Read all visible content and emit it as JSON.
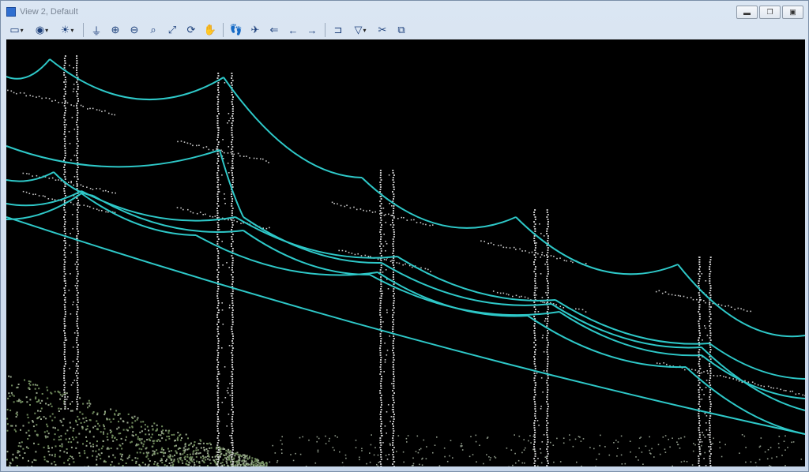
{
  "window": {
    "title": "View 2, Default",
    "controls": [
      "minimize",
      "restore",
      "close"
    ]
  },
  "toolbar": {
    "items": [
      {
        "icon": "view-attributes-icon",
        "glyph": "▭",
        "dropdown": true
      },
      {
        "icon": "display-mode-icon",
        "glyph": "◉",
        "dropdown": true
      },
      {
        "icon": "lighting-icon",
        "glyph": "☀",
        "dropdown": true
      },
      {
        "icon": "update-view-icon",
        "glyph": "⏚",
        "dropdown": false
      },
      {
        "icon": "zoom-in-icon",
        "glyph": "⊕",
        "dropdown": false
      },
      {
        "icon": "zoom-out-icon",
        "glyph": "⊖",
        "dropdown": false
      },
      {
        "icon": "window-area-icon",
        "glyph": "⌕",
        "dropdown": false
      },
      {
        "icon": "fit-view-icon",
        "glyph": "⤢",
        "dropdown": false
      },
      {
        "icon": "rotate-view-icon",
        "glyph": "⟳",
        "dropdown": false
      },
      {
        "icon": "pan-view-icon",
        "glyph": "✋",
        "dropdown": false
      },
      {
        "icon": "walk-icon",
        "glyph": "👣",
        "dropdown": false
      },
      {
        "icon": "fly-icon",
        "glyph": "✈",
        "dropdown": false
      },
      {
        "icon": "view-previous-icon",
        "glyph": "⇐",
        "dropdown": false
      },
      {
        "icon": "view-previous-arrow-icon",
        "glyph": "←",
        "dropdown": false
      },
      {
        "icon": "view-next-arrow-icon",
        "glyph": "→",
        "dropdown": false
      },
      {
        "icon": "clip-volume-icon",
        "glyph": "⊐",
        "dropdown": false
      },
      {
        "icon": "camera-icon",
        "glyph": "▽",
        "dropdown": true
      },
      {
        "icon": "clear-clip-icon",
        "glyph": "✂",
        "dropdown": false
      },
      {
        "icon": "copy-view-icon",
        "glyph": "⧉",
        "dropdown": false
      }
    ]
  },
  "scene": {
    "background": "#000000",
    "wire_color": "#2ec8c8",
    "point_color": "#c8c8c8",
    "vegetation_color": "#6f8a5c"
  }
}
